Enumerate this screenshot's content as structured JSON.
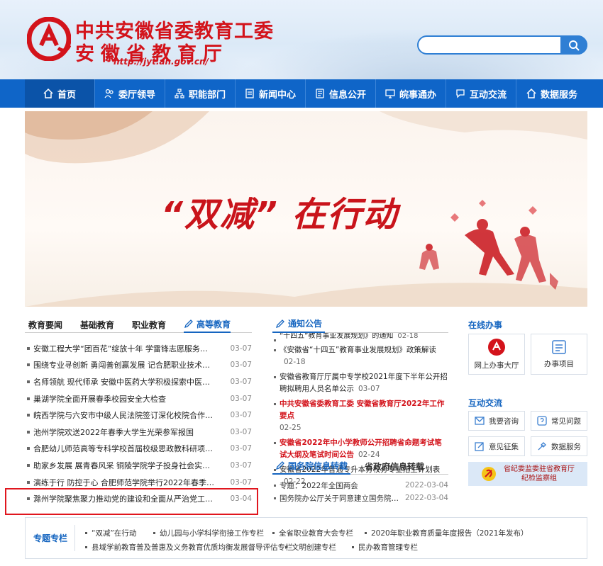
{
  "header": {
    "title_line1": "中共安徽省委教育工委",
    "title_line2": "安徽省教育厅",
    "url": "http://jyt.ah.gov.cn/",
    "search_placeholder": ""
  },
  "nav": [
    {
      "label": "首页",
      "icon": "home-icon"
    },
    {
      "label": "委厅领导",
      "icon": "people-icon"
    },
    {
      "label": "职能部门",
      "icon": "org-chart-icon"
    },
    {
      "label": "新闻中心",
      "icon": "news-icon"
    },
    {
      "label": "信息公开",
      "icon": "document-icon"
    },
    {
      "label": "皖事通办",
      "icon": "monitor-icon"
    },
    {
      "label": "互动交流",
      "icon": "chat-icon"
    },
    {
      "label": "数据服务",
      "icon": "home-icon"
    }
  ],
  "banner": {
    "title": "“双减” 在行动"
  },
  "news_tabs": [
    "教育要闻",
    "基础教育",
    "职业教育",
    "高等教育"
  ],
  "news": [
    {
      "title": "安徽工程大学“团百花”绽放十年 学雷锋志愿服务从...",
      "date": "03-07"
    },
    {
      "title": "围绕专业寻创新 勇闯善创赢发展 记合肥职业技术学...",
      "date": "03-07"
    },
    {
      "title": "名师领航 现代师承 安徽中医药大学积极探索中医药...",
      "date": "03-07"
    },
    {
      "title": "巢湖学院全面开展春季校园安全大检查",
      "date": "03-07"
    },
    {
      "title": "皖西学院与六安市中级人民法院签订深化校院合作协议",
      "date": "03-07"
    },
    {
      "title": "池州学院欢送2022年春季大学生光荣参军报国",
      "date": "03-07"
    },
    {
      "title": "合肥幼儿师范高等专科学校首届校级思政教科研项目...",
      "date": "03-07"
    },
    {
      "title": "助家乡发展 展青春风采 铜陵学院学子投身社会实践...",
      "date": "03-07"
    },
    {
      "title": "演练于行 防控于心 合肥师范学院举行2022年春季学...",
      "date": "03-07"
    },
    {
      "title": "滁州学院聚焦聚力推动党的建设和全面从严治党工作...",
      "date": "03-04"
    }
  ],
  "notice": {
    "title": "通知公告",
    "items": [
      {
        "text": "“十四五”教育事业发展规划》的通知",
        "date": "02-18",
        "red": false
      },
      {
        "text": "《安徽省“十四五”教育事业发展规划》政策解读",
        "date": "02-18",
        "red": false
      },
      {
        "text": "安徽省教育厅厅属中专学校2021年度下半年公开招聘拟聘用人员名单公示",
        "date": "03-07",
        "red": false
      },
      {
        "text": "中共安徽省委教育工委 安徽省教育厅2022年工作要点",
        "date": "02-25",
        "red": true
      },
      {
        "text": "安徽省2022年中小学教师公开招聘省命题考试笔试大纲及笔试时间公告",
        "date": "02-24",
        "red": true
      },
      {
        "text": "安徽省2022年普通专升本分校分专业招生计划表",
        "date": "02-22",
        "red": false
      }
    ]
  },
  "gov_tabs": [
    "国务院信息转载",
    "省政府信息转载"
  ],
  "gov": [
    {
      "title": "专题：2022年全国两会",
      "date": "2022-03-04"
    },
    {
      "title": "国务院办公厅关于同意建立国务院参事建言...",
      "date": "2022-03-04"
    }
  ],
  "online": {
    "title": "在线办事",
    "items": [
      {
        "label": "网上办事大厅",
        "icon": "service-hall-icon"
      },
      {
        "label": "办事项目",
        "icon": "list-icon"
      }
    ]
  },
  "interact": {
    "title": "互动交流",
    "items": [
      {
        "label": "我要咨询",
        "icon": "mail-icon"
      },
      {
        "label": "常见问题",
        "icon": "question-icon"
      },
      {
        "label": "意见征集",
        "icon": "edit-icon"
      },
      {
        "label": "数据服务",
        "icon": "tools-icon"
      }
    ]
  },
  "jiwei": {
    "line1": "省纪委监委驻省教育厅",
    "line2": "纪检监察组"
  },
  "topics": {
    "label": "专题专栏",
    "items": [
      "“双减”在行动",
      "幼儿园与小学科学衔接工作专栏",
      "全省职业教育大会专栏",
      "2020年职业教育质量年度报告（2021年发布）",
      "县域学前教育普及普惠及义务教育优质均衡发展督导评估专栏",
      "文明创建专栏",
      "民办教育管理专栏"
    ]
  },
  "colors": {
    "nav_blue": "#0f65c8",
    "brand_red": "#d3131b",
    "link_blue": "#1565c0"
  }
}
